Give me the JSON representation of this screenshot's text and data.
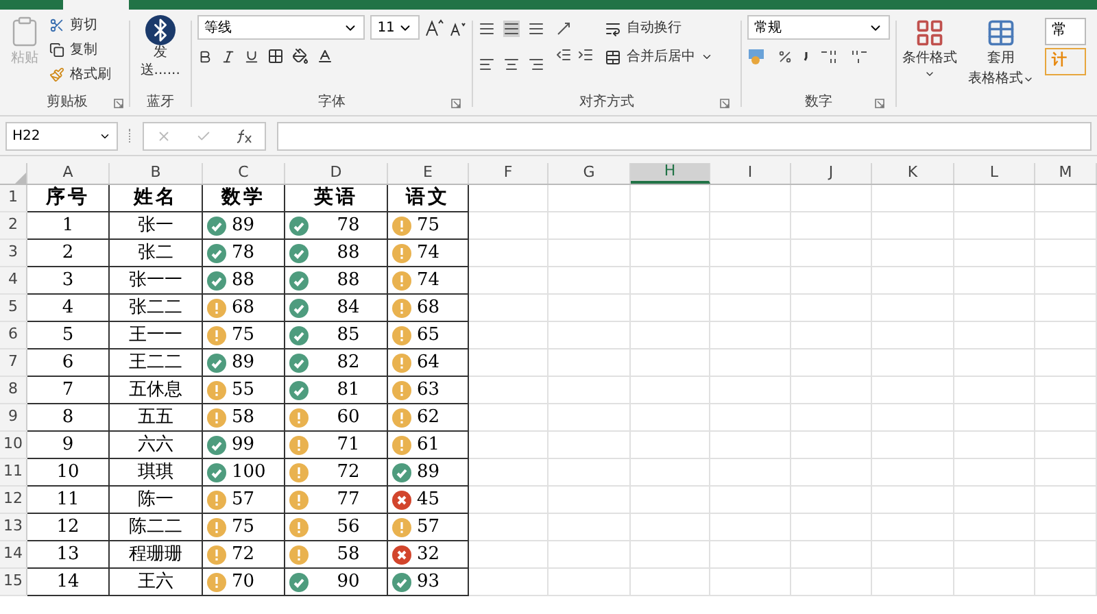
{
  "ribbon": {
    "clipboard": {
      "paste": "粘贴",
      "paste_disabled": true,
      "cut": "剪切",
      "copy": "复制",
      "format_painter": "格式刷",
      "label": "剪贴板"
    },
    "bluetooth": {
      "send": "发送......",
      "label": "蓝牙"
    },
    "font": {
      "name": "等线",
      "size": "11",
      "label": "字体"
    },
    "alignment": {
      "wrap": "自动换行",
      "merge": "合并后居中",
      "label": "对齐方式"
    },
    "number": {
      "format": "常规",
      "label": "数字"
    },
    "styles": {
      "conditional": "条件格式",
      "table_line1": "套用",
      "table_line2": "表格格式",
      "style_normal": "常",
      "style_calc": "计"
    }
  },
  "formula_bar": {
    "name_box": "H22"
  },
  "columns": [
    {
      "label": "A",
      "selected": false
    },
    {
      "label": "B",
      "selected": false
    },
    {
      "label": "C",
      "selected": false
    },
    {
      "label": "D",
      "selected": false
    },
    {
      "label": "E",
      "selected": false
    },
    {
      "label": "F",
      "selected": false
    },
    {
      "label": "G",
      "selected": false
    },
    {
      "label": "H",
      "selected": true
    },
    {
      "label": "I",
      "selected": false
    },
    {
      "label": "J",
      "selected": false
    },
    {
      "label": "K",
      "selected": false
    },
    {
      "label": "L",
      "selected": false
    },
    {
      "label": "M",
      "selected": false
    }
  ],
  "header_row": {
    "row_number": "1",
    "cells": [
      "序号",
      "姓名",
      "数学",
      "英语",
      "语文"
    ]
  },
  "rows": [
    {
      "row_number": "2",
      "index": "1",
      "name": "张一",
      "scores": [
        {
          "kind": "pass",
          "value": "89"
        },
        {
          "kind": "pass",
          "value": "78"
        },
        {
          "kind": "warn",
          "value": "75"
        }
      ]
    },
    {
      "row_number": "3",
      "index": "2",
      "name": "张二",
      "scores": [
        {
          "kind": "pass",
          "value": "78"
        },
        {
          "kind": "pass",
          "value": "88"
        },
        {
          "kind": "warn",
          "value": "74"
        }
      ]
    },
    {
      "row_number": "4",
      "index": "3",
      "name": "张一一",
      "scores": [
        {
          "kind": "pass",
          "value": "88"
        },
        {
          "kind": "pass",
          "value": "88"
        },
        {
          "kind": "warn",
          "value": "74"
        }
      ]
    },
    {
      "row_number": "5",
      "index": "4",
      "name": "张二二",
      "scores": [
        {
          "kind": "warn",
          "value": "68"
        },
        {
          "kind": "pass",
          "value": "84"
        },
        {
          "kind": "warn",
          "value": "68"
        }
      ]
    },
    {
      "row_number": "6",
      "index": "5",
      "name": "王一一",
      "scores": [
        {
          "kind": "warn",
          "value": "75"
        },
        {
          "kind": "pass",
          "value": "85"
        },
        {
          "kind": "warn",
          "value": "65"
        }
      ]
    },
    {
      "row_number": "7",
      "index": "6",
      "name": "王二二",
      "scores": [
        {
          "kind": "pass",
          "value": "89"
        },
        {
          "kind": "pass",
          "value": "82"
        },
        {
          "kind": "warn",
          "value": "64"
        }
      ]
    },
    {
      "row_number": "8",
      "index": "7",
      "name": "五休息",
      "scores": [
        {
          "kind": "warn",
          "value": "55"
        },
        {
          "kind": "pass",
          "value": "81"
        },
        {
          "kind": "warn",
          "value": "63"
        }
      ]
    },
    {
      "row_number": "9",
      "index": "8",
      "name": "五五",
      "scores": [
        {
          "kind": "warn",
          "value": "58"
        },
        {
          "kind": "warn",
          "value": "60"
        },
        {
          "kind": "warn",
          "value": "62"
        }
      ]
    },
    {
      "row_number": "10",
      "index": "9",
      "name": "六六",
      "scores": [
        {
          "kind": "pass",
          "value": "99"
        },
        {
          "kind": "warn",
          "value": "71"
        },
        {
          "kind": "warn",
          "value": "61"
        }
      ]
    },
    {
      "row_number": "11",
      "index": "10",
      "name": "琪琪",
      "scores": [
        {
          "kind": "pass",
          "value": "100"
        },
        {
          "kind": "warn",
          "value": "72"
        },
        {
          "kind": "pass",
          "value": "89"
        }
      ]
    },
    {
      "row_number": "12",
      "index": "11",
      "name": "陈一",
      "scores": [
        {
          "kind": "warn",
          "value": "57"
        },
        {
          "kind": "warn",
          "value": "77"
        },
        {
          "kind": "fail",
          "value": "45"
        }
      ]
    },
    {
      "row_number": "13",
      "index": "12",
      "name": "陈二二",
      "scores": [
        {
          "kind": "warn",
          "value": "75"
        },
        {
          "kind": "warn",
          "value": "56"
        },
        {
          "kind": "warn",
          "value": "57"
        }
      ]
    },
    {
      "row_number": "14",
      "index": "13",
      "name": "程珊珊",
      "scores": [
        {
          "kind": "warn",
          "value": "72"
        },
        {
          "kind": "warn",
          "value": "58"
        },
        {
          "kind": "fail",
          "value": "32"
        }
      ]
    },
    {
      "row_number": "15",
      "index": "14",
      "name": "王六",
      "scores": [
        {
          "kind": "warn",
          "value": "70"
        },
        {
          "kind": "pass",
          "value": "90"
        },
        {
          "kind": "pass",
          "value": "93"
        }
      ]
    }
  ]
}
